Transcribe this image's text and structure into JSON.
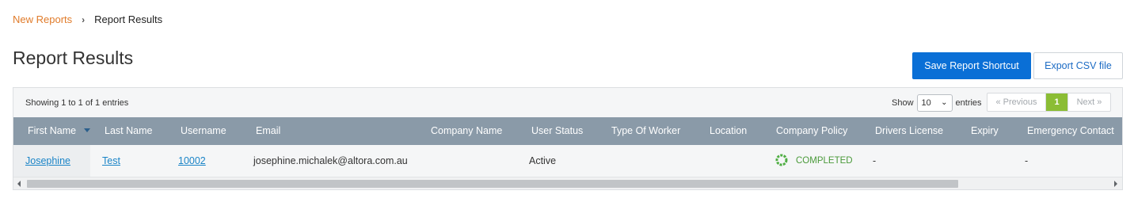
{
  "breadcrumb": {
    "parent": "New Reports",
    "separator": "›",
    "current": "Report Results"
  },
  "page_title": "Report Results",
  "buttons": {
    "save_shortcut": "Save Report Shortcut",
    "export_csv": "Export CSV file"
  },
  "table_info": "Showing 1 to 1 of 1 entries",
  "length_control": {
    "show_label": "Show",
    "value": "10",
    "entries_label": "entries"
  },
  "pagination": {
    "previous": "« Previous",
    "current_page": "1",
    "next": "Next »"
  },
  "columns": [
    "First Name",
    "Last Name",
    "Username",
    "Email",
    "Company Name",
    "User Status",
    "Type Of Worker",
    "Location",
    "Company Policy",
    "Drivers License",
    "Expiry",
    "Emergency Contact"
  ],
  "sort": {
    "column": "First Name",
    "direction": "desc"
  },
  "rows": [
    {
      "first_name": "Josephine",
      "last_name": "Test",
      "username": "10002",
      "email": "josephine.michalek@altora.com.au",
      "company_name": "",
      "user_status": "Active",
      "type_of_worker": "",
      "location": "",
      "company_policy": "COMPLETED",
      "drivers_license": "-",
      "expiry": "",
      "emergency_contact": "-"
    }
  ],
  "icons": {
    "breadcrumb_separator": "chevron-right-icon",
    "sort": "sort-desc-icon",
    "select": "chevron-down-icon",
    "policy_status": "completed-circle-icon"
  },
  "colors": {
    "breadcrumb_link": "#e07b2a",
    "primary_button": "#0a6fd6",
    "header_bg": "#8a9aa8",
    "link": "#1a84c7",
    "pagination_active": "#8bbd35",
    "completed": "#4a9a3a"
  }
}
